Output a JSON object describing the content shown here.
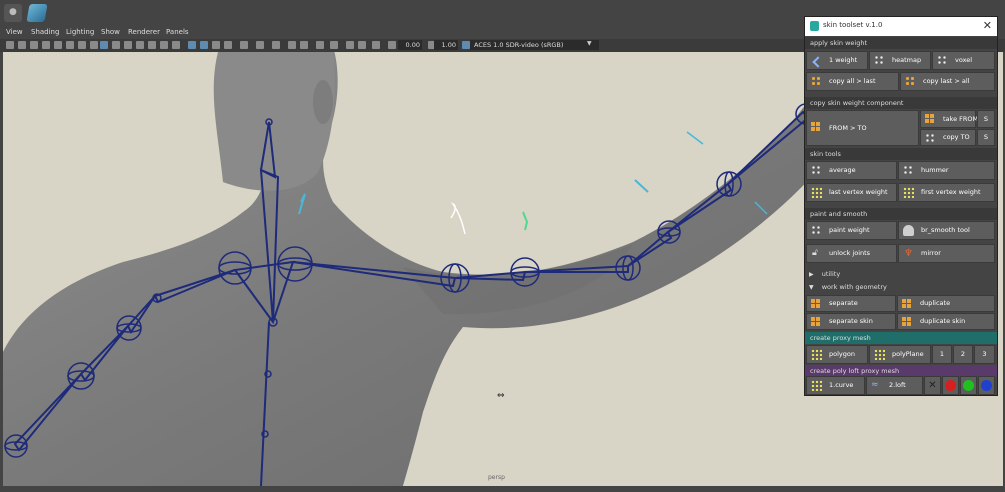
{
  "viewport_menu": [
    "View",
    "Shading",
    "Lighting",
    "Show",
    "Renderer",
    "Panels"
  ],
  "viewbar": {
    "value1": "0.00",
    "value2": "1.00",
    "color_management": "ACES 1.0 SDR-video (sRGB)"
  },
  "viewport_label": "persp",
  "panel": {
    "title": "skin toolset v.1.0",
    "sections": {
      "apply_skin_weight": "apply skin weight",
      "copy_skin_weight_component": "copy skin weight component",
      "skin_tools": "skin tools",
      "paint_and_smooth": "paint and smooth",
      "utility": "utility",
      "work_with_geometry": "work with geometry",
      "create_proxy_mesh": "create proxy mesh",
      "create_poly_loft_proxy_mesh": "create poly loft proxy mesh"
    },
    "buttons": {
      "one_weight": "1 weight",
      "heatmap": "heatmap",
      "voxel": "voxel",
      "copy_all_last": "copy all > last",
      "copy_last_all": "copy last > all",
      "from_to": "FROM > TO",
      "take_from": "take FROM",
      "copy_to": "copy TO",
      "s1": "S",
      "s2": "S",
      "average": "average",
      "hummer": "hummer",
      "last_vertex_weight": "last vertex weight",
      "first_vertex_weight": "first vertex weight",
      "paint_weight": "paint weight",
      "br_smooth_tool": "br_smooth tool",
      "unlock_joints": "unlock joints",
      "mirror": "mirror",
      "separate": "separate",
      "duplicate": "duplicate",
      "separate_skin": "separate skin",
      "duplicate_skin": "duplicate skin",
      "polygon": "polygon",
      "polyplane": "polyPlane",
      "n1": "1",
      "n2": "2",
      "n3": "3",
      "curve": "1.curve",
      "loft": "2.loft"
    },
    "colors": {
      "red": "#d62020",
      "green": "#20c020",
      "blue": "#2040d0"
    }
  }
}
